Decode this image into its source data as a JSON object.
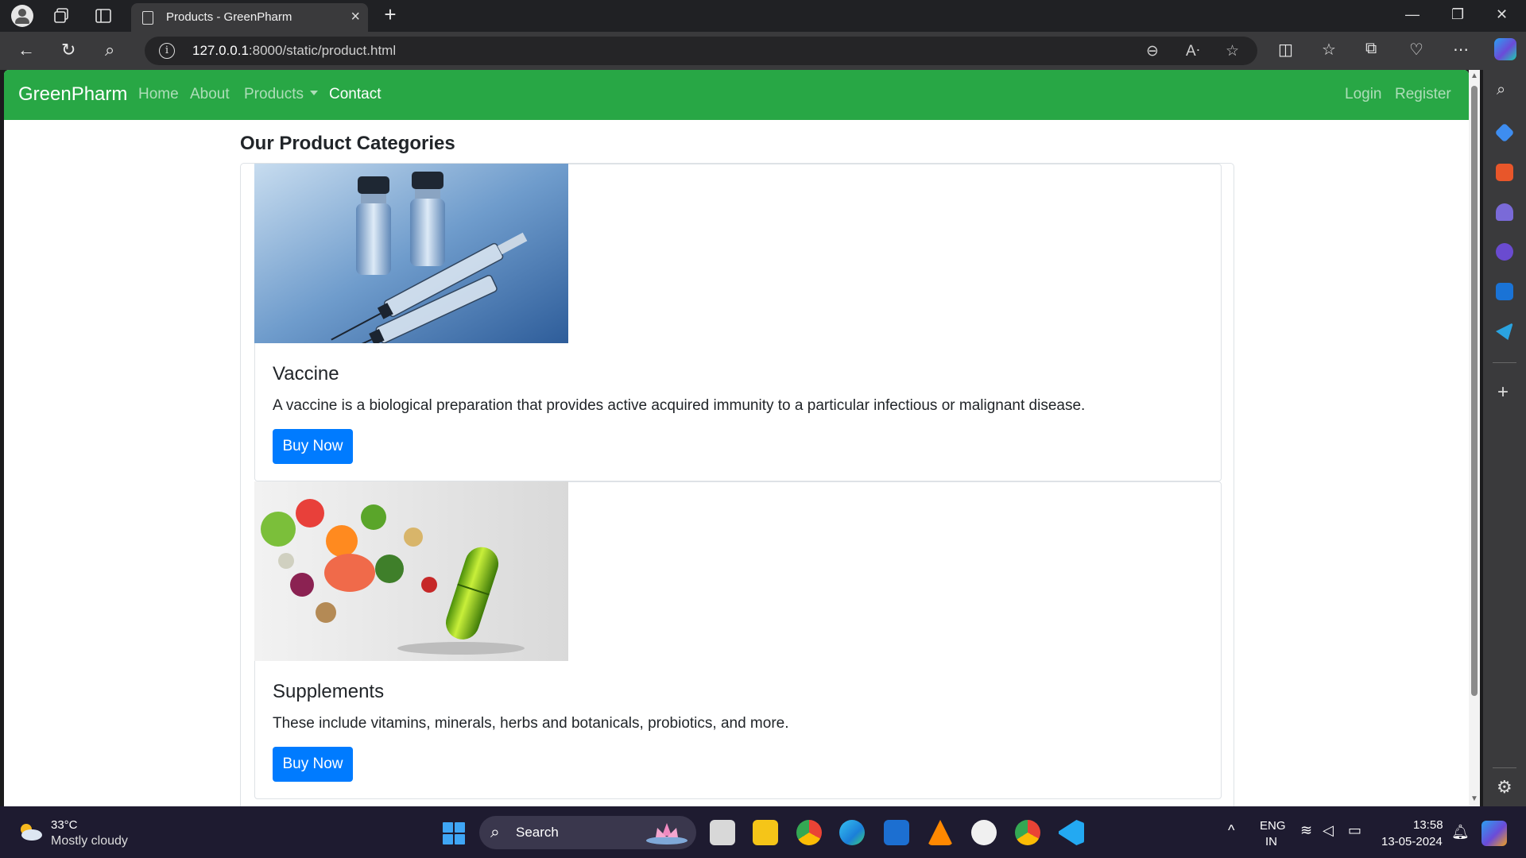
{
  "browser": {
    "tab_title": "Products - GreenPharm",
    "url_host": "127.0.0.1",
    "url_rest": ":8000/static/product.html"
  },
  "site": {
    "brand": "GreenPharm",
    "nav": [
      {
        "label": "Home"
      },
      {
        "label": "About"
      },
      {
        "label": "Products"
      },
      {
        "label": "Contact"
      }
    ],
    "right_nav": [
      {
        "label": "Login"
      },
      {
        "label": "Register"
      }
    ],
    "accent_color": "#28a745",
    "button_color": "#007bff"
  },
  "page": {
    "heading": "Our Product Categories",
    "products": [
      {
        "name": "Vaccine",
        "description": "A vaccine is a biological preparation that provides active acquired immunity to a particular infectious or malignant disease.",
        "button": "Buy Now",
        "image": "vials-and-syringes-photo"
      },
      {
        "name": "Supplements",
        "description": "These include vitamins, minerals, herbs and botanicals, probiotics, and more.",
        "button": "Buy Now",
        "image": "vegetables-and-capsule-photo"
      }
    ]
  },
  "taskbar": {
    "temperature": "33°C",
    "weather": "Mostly cloudy",
    "search_label": "Search",
    "lang_top": "ENG",
    "lang_bottom": "IN",
    "time": "13:58",
    "date": "13-05-2024"
  }
}
